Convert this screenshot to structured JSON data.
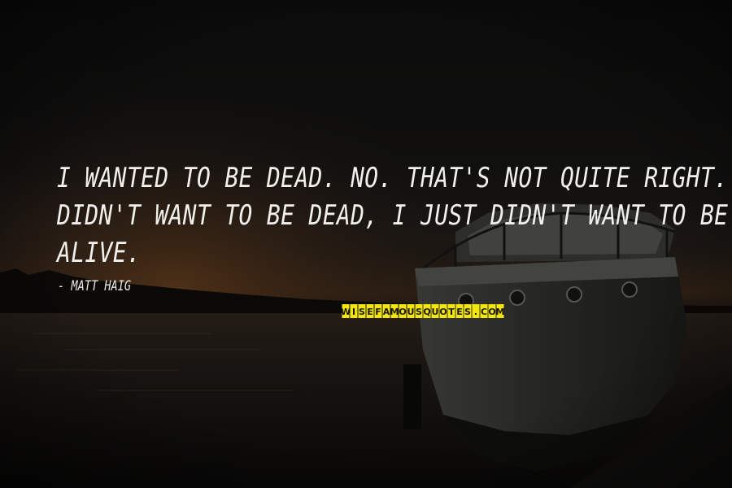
{
  "quote": {
    "lines": [
      "I WANTED TO BE DEAD. NO. THAT'S NOT QUITE RIGHT. I",
      "DIDN'T WANT TO BE DEAD, I JUST DIDN'T WANT TO BE",
      "ALIVE."
    ]
  },
  "author": "- MATT HAIG",
  "watermark": {
    "text": "WISEFAMOUSQUOTES.COM",
    "colors": {
      "tile": "#f5e60a",
      "letters": "#1a1a1a"
    }
  },
  "colors": {
    "sky_top": "#151515",
    "sunset_glow": "#7a4a22",
    "water": "#2a2520",
    "boat": "#3a3a36",
    "text": "#f1f0ec"
  },
  "icons": [
    "boat-illustration",
    "sunset-sky",
    "water-reflection"
  ]
}
